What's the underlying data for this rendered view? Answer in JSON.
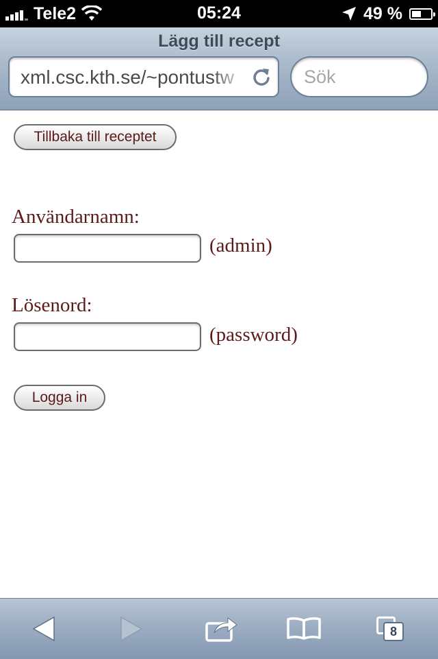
{
  "status_bar": {
    "carrier": "Tele2",
    "time": "05:24",
    "battery": "49 %",
    "battery_level": 0.49,
    "signal_bars": 4
  },
  "browser": {
    "page_title": "Lägg till recept",
    "url": "xml.csc.kth.se/~pontustw",
    "search_placeholder": "Sök"
  },
  "page": {
    "back_button_label": "Tillbaka till receptet",
    "username_label": "Användarnamn:",
    "username_hint": "(admin)",
    "username_value": "",
    "password_label": "Lösenord:",
    "password_hint": "(password)",
    "password_value": "",
    "login_button_label": "Logga in"
  },
  "toolbar": {
    "tab_count": "8",
    "icons": [
      "back-arrow-icon",
      "forward-arrow-icon",
      "share-icon",
      "bookmarks-icon",
      "tabs-icon"
    ]
  },
  "colors": {
    "link_text": "#5e1a1a",
    "header_bar": "#a9b9cb",
    "status_bar": "#000000"
  }
}
